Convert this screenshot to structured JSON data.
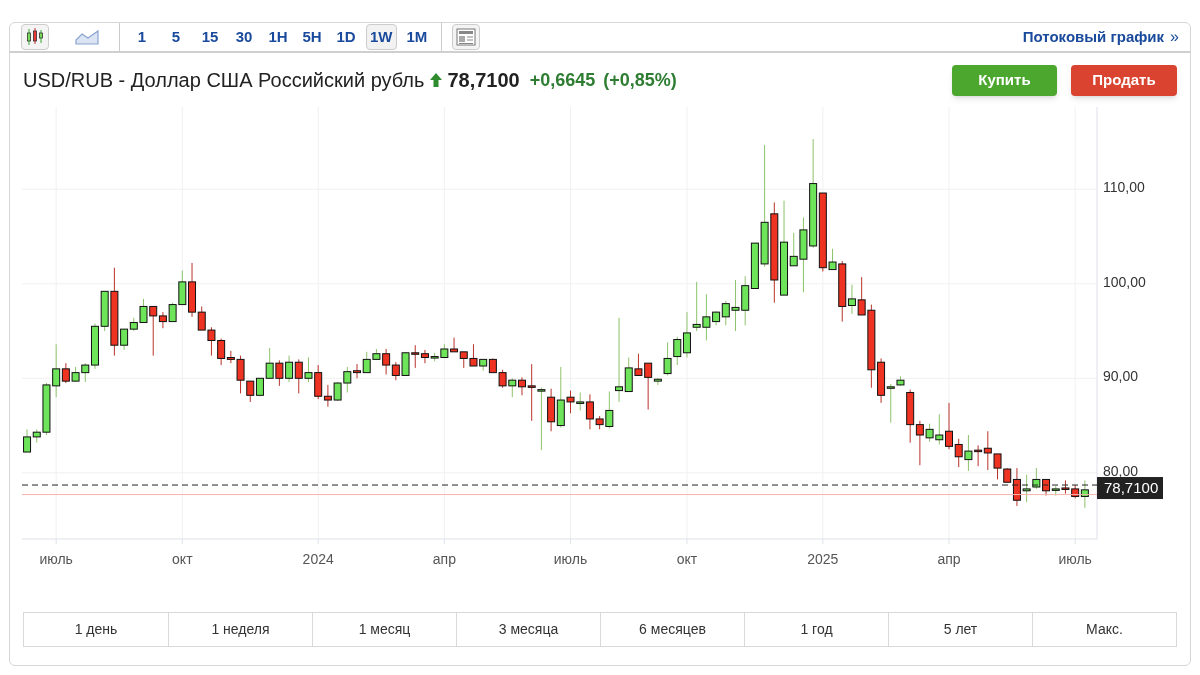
{
  "toolbar": {
    "chart_types": [
      {
        "kind": "candles",
        "selected": true
      },
      {
        "kind": "area",
        "selected": false
      }
    ],
    "intervals": [
      {
        "label": "1",
        "selected": false
      },
      {
        "label": "5",
        "selected": false
      },
      {
        "label": "15",
        "selected": false
      },
      {
        "label": "30",
        "selected": false
      },
      {
        "label": "1H",
        "selected": false
      },
      {
        "label": "5H",
        "selected": false
      },
      {
        "label": "1D",
        "selected": false
      },
      {
        "label": "1W",
        "selected": true
      },
      {
        "label": "1M",
        "selected": false
      }
    ],
    "streaming_link": "Потоковый график",
    "link_arrow": "»"
  },
  "header": {
    "title": "USD/RUB - Доллар США Российский рубль",
    "rising": true,
    "price": "78,7100",
    "change": "+0,6645",
    "change_pct": "(+0,85%)",
    "buy": "Купить",
    "sell": "Продать"
  },
  "chart": {
    "chart_data": {
      "type": "candlestick",
      "ylim": [
        73,
        118.7
      ],
      "grid": true,
      "yticks": [
        {
          "value": 80,
          "label": "80,00"
        },
        {
          "value": 90,
          "label": "90,00"
        },
        {
          "value": 100,
          "label": "100,00"
        },
        {
          "value": 110,
          "label": "110,00"
        }
      ],
      "ref_lines": [
        {
          "axis": "y",
          "value": 78.71,
          "label": "78,7100",
          "color": "#222222"
        },
        {
          "axis": "y",
          "value": 77.7,
          "color": "#f5b5ad"
        }
      ],
      "categories": [
        null,
        null,
        null,
        "июль",
        null,
        null,
        null,
        null,
        null,
        null,
        null,
        null,
        null,
        null,
        null,
        null,
        "окт",
        null,
        null,
        null,
        null,
        null,
        null,
        null,
        null,
        null,
        null,
        null,
        null,
        null,
        "2024",
        null,
        null,
        null,
        null,
        null,
        null,
        null,
        null,
        null,
        null,
        null,
        null,
        "апр",
        null,
        null,
        null,
        null,
        null,
        null,
        null,
        null,
        null,
        null,
        null,
        null,
        "июль",
        null,
        null,
        null,
        null,
        null,
        null,
        null,
        null,
        null,
        null,
        null,
        "окт",
        null,
        null,
        null,
        null,
        null,
        null,
        null,
        null,
        null,
        null,
        null,
        null,
        null,
        "2025",
        null,
        null,
        null,
        null,
        null,
        null,
        null,
        null,
        null,
        null,
        null,
        null,
        "апр",
        null,
        null,
        null,
        null,
        null,
        null,
        null,
        null,
        null,
        null,
        null,
        null,
        "июль",
        null
      ],
      "ohlc": [
        [
          82.2,
          84.6,
          82.2,
          83.8
        ],
        [
          83.8,
          84.6,
          83.2,
          84.3
        ],
        [
          84.3,
          89.5,
          84.0,
          89.3
        ],
        [
          89.2,
          93.6,
          88.0,
          91.0
        ],
        [
          91.0,
          91.6,
          89.5,
          89.7
        ],
        [
          89.7,
          91.2,
          89.6,
          90.6
        ],
        [
          90.6,
          91.6,
          89.6,
          91.4
        ],
        [
          91.4,
          95.8,
          91.0,
          95.5
        ],
        [
          95.5,
          99.2,
          95.0,
          99.2
        ],
        [
          99.2,
          101.7,
          92.4,
          93.5
        ],
        [
          93.5,
          95.2,
          93.0,
          95.2
        ],
        [
          95.2,
          96.4,
          95.0,
          95.9
        ],
        [
          95.9,
          98.4,
          95.9,
          97.6
        ],
        [
          97.6,
          97.6,
          92.4,
          96.6
        ],
        [
          96.6,
          97.0,
          95.3,
          96.0
        ],
        [
          96.0,
          98.0,
          96.0,
          97.8
        ],
        [
          97.8,
          101.4,
          97.8,
          100.2
        ],
        [
          100.2,
          102.2,
          96.5,
          97.0
        ],
        [
          97.0,
          97.6,
          95.1,
          95.1
        ],
        [
          95.1,
          95.4,
          92.4,
          94.0
        ],
        [
          94.0,
          94.2,
          91.4,
          92.1
        ],
        [
          92.2,
          92.9,
          91.6,
          92.0
        ],
        [
          92.0,
          92.4,
          88.4,
          89.8
        ],
        [
          89.7,
          89.7,
          87.5,
          88.2
        ],
        [
          88.2,
          90.0,
          88.1,
          90.0
        ],
        [
          90.0,
          93.2,
          90.0,
          91.6
        ],
        [
          91.6,
          91.9,
          89.2,
          90.0
        ],
        [
          90.0,
          92.4,
          89.6,
          91.7
        ],
        [
          91.7,
          92.0,
          88.4,
          90.0
        ],
        [
          90.0,
          92.2,
          89.6,
          90.6
        ],
        [
          90.6,
          91.4,
          87.8,
          88.1
        ],
        [
          88.1,
          89.3,
          87.0,
          87.7
        ],
        [
          87.7,
          89.6,
          87.6,
          89.5
        ],
        [
          89.5,
          91.2,
          88.5,
          90.7
        ],
        [
          90.8,
          91.5,
          90.0,
          90.6
        ],
        [
          90.6,
          92.8,
          90.6,
          92.0
        ],
        [
          92.0,
          93.1,
          92.0,
          92.6
        ],
        [
          92.6,
          93.1,
          90.4,
          91.4
        ],
        [
          91.4,
          91.7,
          89.8,
          90.3
        ],
        [
          90.3,
          92.8,
          90.3,
          92.7
        ],
        [
          92.7,
          93.5,
          91.1,
          92.6
        ],
        [
          92.6,
          93.0,
          91.6,
          92.2
        ],
        [
          92.2,
          92.7,
          91.8,
          92.3
        ],
        [
          92.2,
          93.6,
          92.2,
          93.1
        ],
        [
          93.1,
          94.3,
          92.8,
          92.8
        ],
        [
          92.8,
          92.8,
          91.1,
          92.1
        ],
        [
          92.1,
          93.6,
          91.3,
          91.3
        ],
        [
          91.3,
          92.0,
          90.8,
          92.0
        ],
        [
          92.0,
          92.1,
          90.6,
          90.6
        ],
        [
          90.6,
          90.9,
          89.0,
          89.2
        ],
        [
          89.2,
          90.0,
          88.0,
          89.8
        ],
        [
          89.8,
          90.1,
          88.2,
          89.1
        ],
        [
          89.2,
          91.5,
          85.5,
          89.1
        ],
        [
          88.7,
          89.0,
          82.4,
          88.8
        ],
        [
          88.0,
          88.9,
          84.4,
          85.4
        ],
        [
          85.0,
          91.2,
          84.8,
          87.7
        ],
        [
          88.0,
          88.7,
          86.3,
          87.5
        ],
        [
          87.4,
          88.5,
          86.6,
          87.5
        ],
        [
          87.5,
          88.3,
          84.6,
          85.7
        ],
        [
          85.7,
          86.0,
          84.6,
          85.1
        ],
        [
          84.9,
          88.6,
          84.7,
          86.6
        ],
        [
          88.7,
          96.4,
          87.5,
          89.1
        ],
        [
          88.6,
          92.2,
          88.6,
          91.1
        ],
        [
          91.0,
          92.6,
          90.3,
          90.3
        ],
        [
          91.6,
          91.6,
          86.7,
          90.1
        ],
        [
          89.7,
          90.0,
          89.3,
          89.9
        ],
        [
          90.5,
          93.8,
          90.3,
          92.1
        ],
        [
          92.3,
          94.4,
          91.4,
          94.1
        ],
        [
          92.7,
          97.0,
          92.2,
          94.8
        ],
        [
          95.4,
          100.2,
          95.0,
          95.7
        ],
        [
          95.4,
          98.9,
          94.0,
          96.5
        ],
        [
          96.0,
          97.1,
          95.6,
          97.0
        ],
        [
          96.5,
          98.2,
          95.6,
          97.9
        ],
        [
          97.2,
          100.4,
          95.0,
          97.5
        ],
        [
          97.2,
          100.8,
          95.6,
          99.8
        ],
        [
          99.5,
          104.3,
          99.5,
          104.3
        ],
        [
          102.1,
          114.7,
          101.8,
          106.5
        ],
        [
          107.4,
          108.6,
          98.0,
          100.4
        ],
        [
          98.8,
          108.8,
          98.8,
          104.4
        ],
        [
          101.9,
          105.4,
          101.9,
          102.9
        ],
        [
          102.6,
          107.0,
          99.1,
          105.7
        ],
        [
          104.0,
          115.3,
          103.8,
          110.6
        ],
        [
          109.6,
          109.6,
          101.3,
          101.7
        ],
        [
          101.5,
          103.7,
          101.5,
          102.3
        ],
        [
          102.1,
          102.4,
          96.0,
          97.6
        ],
        [
          97.7,
          99.9,
          96.8,
          98.4
        ],
        [
          98.3,
          100.7,
          96.7,
          96.7
        ],
        [
          97.2,
          97.8,
          89.0,
          90.9
        ],
        [
          91.7,
          92.1,
          87.4,
          88.2
        ],
        [
          89.0,
          89.4,
          85.3,
          89.1
        ],
        [
          89.3,
          90.2,
          89.2,
          89.8
        ],
        [
          88.5,
          88.8,
          83.2,
          85.1
        ],
        [
          85.1,
          85.5,
          80.8,
          84.0
        ],
        [
          83.7,
          85.2,
          83.3,
          84.6
        ],
        [
          83.5,
          86.2,
          83.0,
          84.0
        ],
        [
          84.4,
          87.4,
          82.5,
          82.8
        ],
        [
          83.0,
          83.6,
          80.6,
          81.7
        ],
        [
          81.4,
          84.0,
          80.2,
          82.3
        ],
        [
          82.4,
          82.9,
          80.7,
          82.3
        ],
        [
          82.6,
          84.4,
          80.3,
          82.1
        ],
        [
          82.0,
          82.0,
          79.3,
          80.5
        ],
        [
          80.4,
          80.5,
          79.0,
          79.0
        ],
        [
          79.3,
          80.5,
          76.5,
          77.1
        ],
        [
          78.1,
          79.8,
          76.9,
          78.3
        ],
        [
          78.5,
          80.5,
          78.3,
          79.3
        ],
        [
          79.3,
          79.3,
          77.6,
          78.1
        ],
        [
          78.2,
          78.6,
          77.6,
          78.3
        ],
        [
          78.4,
          79.2,
          77.8,
          78.3
        ],
        [
          78.3,
          78.7,
          77.3,
          77.5
        ],
        [
          77.5,
          79.2,
          76.3,
          78.2
        ]
      ]
    }
  },
  "ranges": [
    {
      "label": "1 день",
      "selected": false
    },
    {
      "label": "1 неделя",
      "selected": false
    },
    {
      "label": "1 месяц",
      "selected": false
    },
    {
      "label": "3 месяца",
      "selected": false
    },
    {
      "label": "6 месяцев",
      "selected": false
    },
    {
      "label": "1 год",
      "selected": false
    },
    {
      "label": "5 лет",
      "selected": false
    },
    {
      "label": "Макс.",
      "selected": false
    }
  ]
}
